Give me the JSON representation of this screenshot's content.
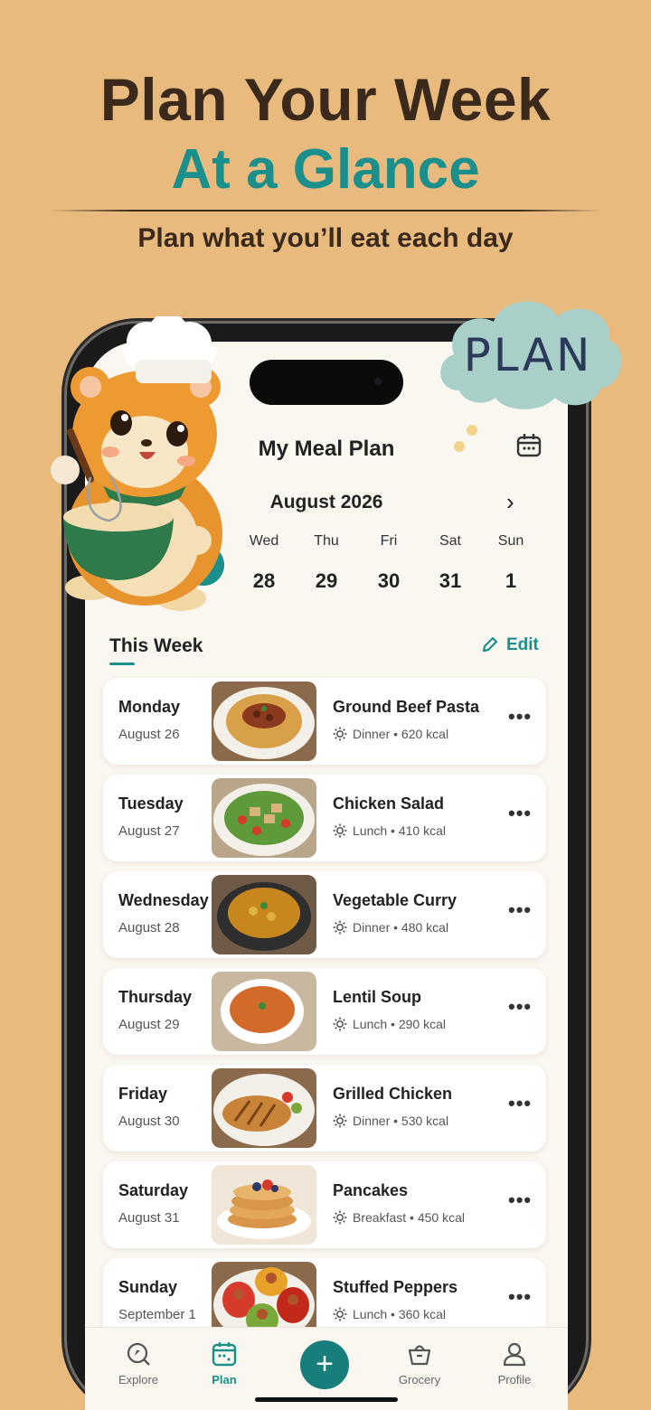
{
  "hero": {
    "line1": "Plan Your Week",
    "line2": "At a Glance",
    "subtitle": "Plan what you’ll eat each day",
    "badge": "PLAN"
  },
  "colors": {
    "background": "#E9BA7E",
    "accent": "#1A8F8C",
    "heading": "#3B2A1C"
  },
  "app": {
    "title": "My Meal Plan",
    "calendar_icon": "calendar-icon",
    "month": "August 2026",
    "next_icon": "chevron-right-icon",
    "days": [
      {
        "name": "Wed",
        "num": "28"
      },
      {
        "name": "Thu",
        "num": "29"
      },
      {
        "name": "Fri",
        "num": "30"
      },
      {
        "name": "Sat",
        "num": "31"
      },
      {
        "name": "Sun",
        "num": "1"
      }
    ],
    "selected_day": "7",
    "week_title": "This Week",
    "edit_label": "Edit"
  },
  "meals": [
    {
      "day": "Monday",
      "date": "August 26",
      "name": "Ground Beef Pasta",
      "meta": "Dinner • 620 kcal"
    },
    {
      "day": "Tuesday",
      "date": "August 27",
      "name": "Chicken Salad",
      "meta": "Lunch • 410 kcal"
    },
    {
      "day": "Wednesday",
      "date": "August 28",
      "name": "Vegetable Curry",
      "meta": "Dinner • 480 kcal"
    },
    {
      "day": "Thursday",
      "date": "August 29",
      "name": "Lentil Soup",
      "meta": "Lunch • 290 kcal"
    },
    {
      "day": "Friday",
      "date": "August 30",
      "name": "Grilled Chicken",
      "meta": "Dinner • 530 kcal"
    },
    {
      "day": "Saturday",
      "date": "August 31",
      "name": "Pancakes",
      "meta": "Breakfast • 450 kcal"
    },
    {
      "day": "Sunday",
      "date": "September 1",
      "name": "Stuffed Peppers",
      "meta": "Lunch • 360 kcal"
    }
  ],
  "tabs": [
    {
      "label": "Explore",
      "icon": "explore-icon"
    },
    {
      "label": "Plan",
      "icon": "calendar-icon"
    },
    {
      "label": "",
      "icon": "plus-icon"
    },
    {
      "label": "Grocery",
      "icon": "basket-icon"
    },
    {
      "label": "Profile",
      "icon": "user-icon"
    }
  ],
  "more_glyph": "•••",
  "fab_glyph": "+"
}
